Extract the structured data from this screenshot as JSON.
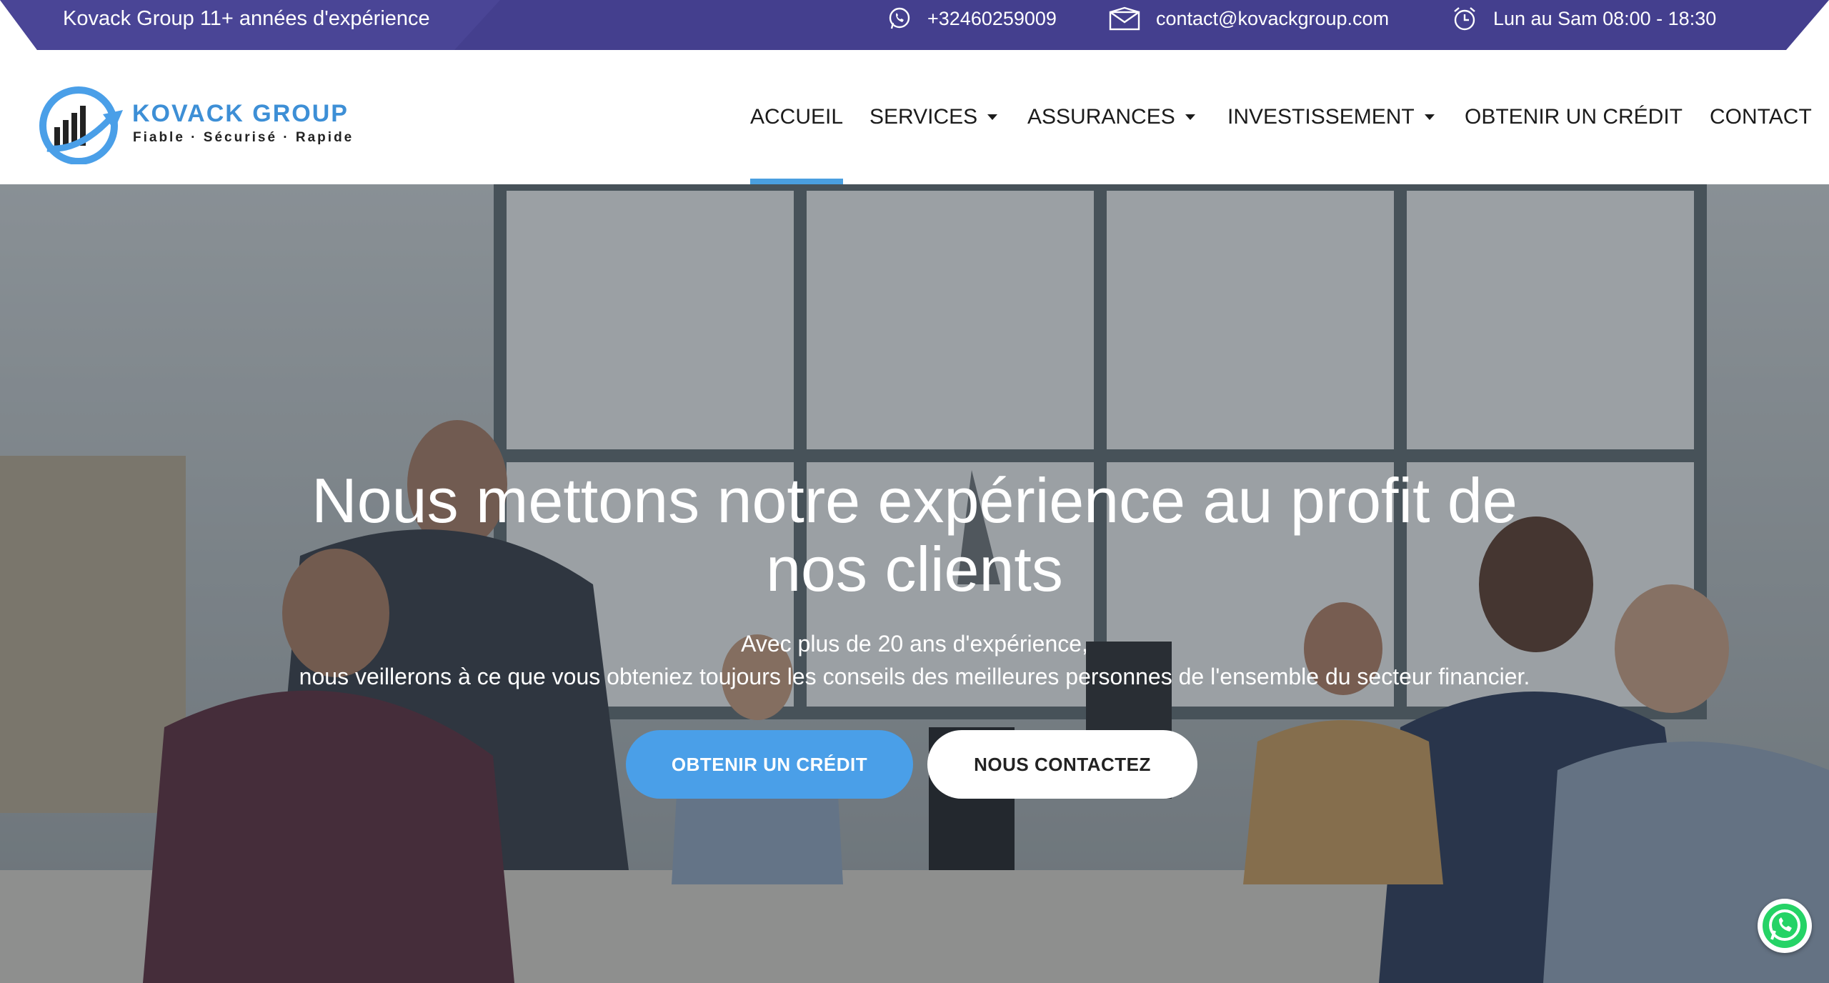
{
  "topbar": {
    "tagline": "Kovack Group 11+ années d'expérience",
    "phone": "+32460259009",
    "email": "contact@kovackgroup.com",
    "hours": "Lun au Sam 08:00 - 18:30",
    "icons": {
      "phone": "whatsapp-icon",
      "email": "envelope-icon",
      "hours": "alarm-clock-icon"
    }
  },
  "logo": {
    "title": "KOVACK  GROUP",
    "subtitle": "Fiable · Sécurisé · Rapide"
  },
  "nav": {
    "items": [
      {
        "label": "ACCUEIL",
        "active": true,
        "dropdown": false
      },
      {
        "label": "SERVICES",
        "active": false,
        "dropdown": true
      },
      {
        "label": "ASSURANCES",
        "active": false,
        "dropdown": true
      },
      {
        "label": "INVESTISSEMENT",
        "active": false,
        "dropdown": true
      },
      {
        "label": "OBTENIR UN CRÉDIT",
        "active": false,
        "dropdown": false
      },
      {
        "label": "CONTACT",
        "active": false,
        "dropdown": false
      }
    ]
  },
  "hero": {
    "title_line1": "Nous mettons notre expérience au profit de",
    "title_line2": "nos clients",
    "sub_line1": "Avec plus de 20 ans d'expérience,",
    "sub_line2": "nous veillerons à ce que vous obteniez toujours les conseils des meilleures personnes de l'ensemble du secteur financier.",
    "primary_button": "OBTENIR UN CRÉDIT",
    "secondary_button": "NOUS CONTACTEZ"
  },
  "colors": {
    "topbar": "#443f8e",
    "accent": "#4a9fe8",
    "nav_text": "#1b1b1b",
    "whatsapp": "#25d366"
  }
}
